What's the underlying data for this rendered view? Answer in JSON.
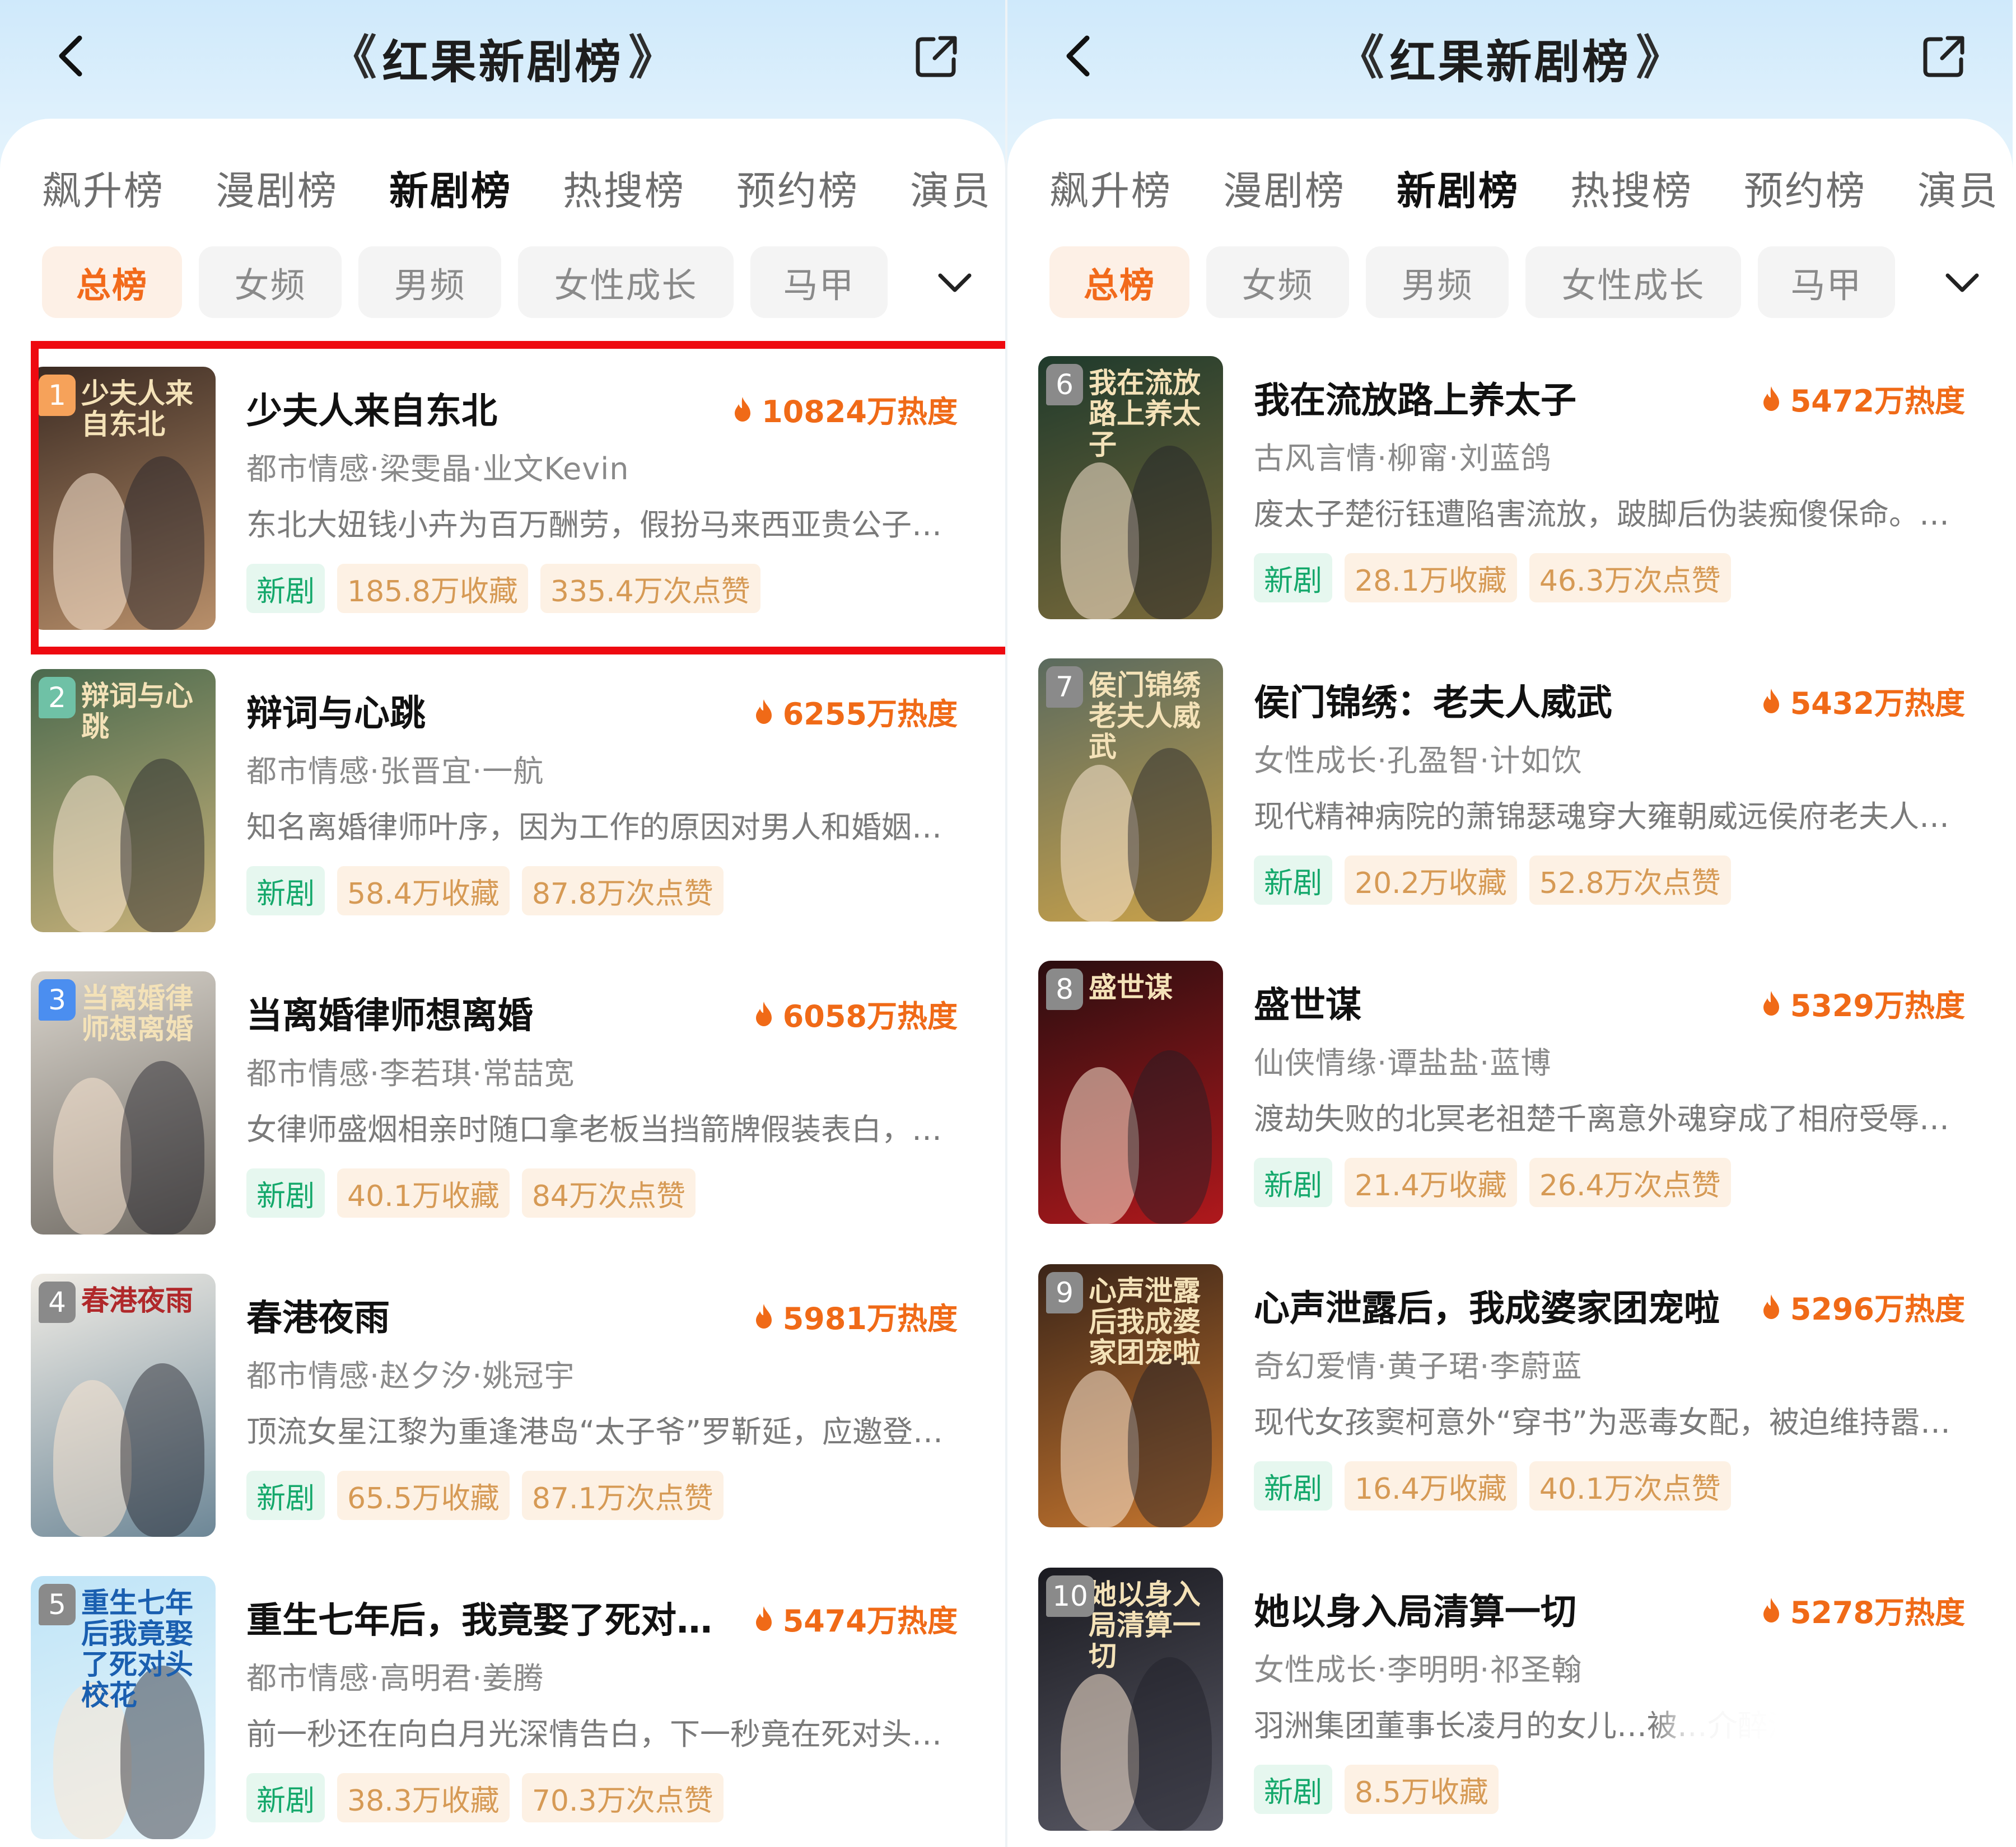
{
  "colors": {
    "accent_orange": "#f06a17",
    "tag_green": "#14a86b",
    "highlight_red": "#ee0a10",
    "header_blue": "#cfe9fb"
  },
  "panels": [
    {
      "header": {
        "title": "红果新剧榜",
        "title_deco_left": "《",
        "title_deco_right": "》"
      },
      "tabs": [
        "飙升榜",
        "漫剧榜",
        "新剧榜",
        "热搜榜",
        "预约榜",
        "演员"
      ],
      "active_tab": 2,
      "filters": [
        "总榜",
        "女频",
        "男频",
        "女性成长",
        "马甲"
      ],
      "active_filter": 0,
      "items": [
        {
          "rank": "1",
          "title": "少夫人来自东北",
          "heat": "10824万热度",
          "meta": "都市情感·梁雯晶·业文Kevin",
          "synopsis": "东北大妞钱小卉为百万酬劳，假扮马来西亚贵公子…",
          "tag_new": "新剧",
          "collect": "185.8万收藏",
          "likes": "335.4万次点赞",
          "poster_text": "少夫人来自东北",
          "rank_color": "#f6a25a",
          "poster_colors": [
            "#3a2a22",
            "#b88f6a"
          ],
          "highlighted": true
        },
        {
          "rank": "2",
          "title": "辩词与心跳",
          "heat": "6255万热度",
          "meta": "都市情感·张晋宜·一航",
          "synopsis": "知名离婚律师叶序，因为工作的原因对男人和婚姻…",
          "tag_new": "新剧",
          "collect": "58.4万收藏",
          "likes": "87.8万次点赞",
          "poster_text": "辩词与心跳",
          "rank_color": "#6fc1a6",
          "poster_colors": [
            "#4b6a4e",
            "#c9b27a"
          ],
          "highlighted": false
        },
        {
          "rank": "3",
          "title": "当离婚律师想离婚",
          "heat": "6058万热度",
          "meta": "都市情感·李若琪·常喆宽",
          "synopsis": "女律师盛烟相亲时随口拿老板当挡箭牌假装表白，…",
          "tag_new": "新剧",
          "collect": "40.1万收藏",
          "likes": "84万次点赞",
          "poster_text": "当离婚律师想离婚",
          "rank_color": "#4b8ef0",
          "poster_colors": [
            "#d9d4cc",
            "#6f6a63"
          ],
          "highlighted": false
        },
        {
          "rank": "4",
          "title": "春港夜雨",
          "heat": "5981万热度",
          "meta": "都市情感·赵夕汐·姚冠宇",
          "synopsis": "顶流女星江黎为重逢港岛“太子爷”罗靳延，应邀登…",
          "tag_new": "新剧",
          "collect": "65.5万收藏",
          "likes": "87.1万次点赞",
          "poster_text": "春港夜雨",
          "rank_color": "#8a8a8a",
          "poster_colors": [
            "#f1ede6",
            "#6d8797"
          ],
          "highlighted": false
        },
        {
          "rank": "5",
          "title": "重生七年后，我竟娶了死对头…",
          "heat": "5474万热度",
          "meta": "都市情感·高明君·姜腾",
          "synopsis": "前一秒还在向白月光深情告白，下一秒竟在死对头…",
          "tag_new": "新剧",
          "collect": "38.3万收藏",
          "likes": "70.3万次点赞",
          "poster_text": "重生七年后我竟娶了死对头校花",
          "rank_color": "#8a8a8a",
          "poster_colors": [
            "#bfe4f7",
            "#e9f6fb"
          ],
          "highlighted": false
        }
      ]
    },
    {
      "header": {
        "title": "红果新剧榜",
        "title_deco_left": "《",
        "title_deco_right": "》"
      },
      "tabs": [
        "飙升榜",
        "漫剧榜",
        "新剧榜",
        "热搜榜",
        "预约榜",
        "演员"
      ],
      "active_tab": 2,
      "filters": [
        "总榜",
        "女频",
        "男频",
        "女性成长",
        "马甲"
      ],
      "active_filter": 0,
      "items": [
        {
          "rank": "6",
          "title": "我在流放路上养太子",
          "heat": "5472万热度",
          "meta": "古风言情·柳甯·刘蓝鸽",
          "synopsis": "废太子楚衍钰遭陷害流放，跛脚后伪装痴傻保命。…",
          "tag_new": "新剧",
          "collect": "28.1万收藏",
          "likes": "46.3万次点赞",
          "poster_text": "我在流放路上养太子",
          "rank_color": "#8a8a8a",
          "poster_colors": [
            "#1f3a2c",
            "#7a6a3a"
          ],
          "highlighted": false
        },
        {
          "rank": "7",
          "title": "侯门锦绣：老夫人威武",
          "heat": "5432万热度",
          "meta": "女性成长·孔盈智·计如饮",
          "synopsis": "现代精神病院的萧锦瑟魂穿大雍朝威远侯府老夫人…",
          "tag_new": "新剧",
          "collect": "20.2万收藏",
          "likes": "52.8万次点赞",
          "poster_text": "侯门锦绣老夫人威武",
          "rank_color": "#8a8a8a",
          "poster_colors": [
            "#5a6a5e",
            "#caa24a"
          ],
          "highlighted": false
        },
        {
          "rank": "8",
          "title": "盛世谋",
          "heat": "5329万热度",
          "meta": "仙侠情缘·谭盐盐·蓝博",
          "synopsis": "渡劫失败的北冥老祖楚千离意外魂穿成了相府受辱…",
          "tag_new": "新剧",
          "collect": "21.4万收藏",
          "likes": "26.4万次点赞",
          "poster_text": "盛世谋",
          "rank_color": "#8a8a8a",
          "poster_colors": [
            "#2a0e10",
            "#b0181c"
          ],
          "highlighted": false
        },
        {
          "rank": "9",
          "title": "心声泄露后，我成婆家团宠啦",
          "heat": "5296万热度",
          "meta": "奇幻爱情·黄子珺·李蔚蓝",
          "synopsis": "现代女孩窦柯意外“穿书”为恶毒女配，被迫维持嚣…",
          "tag_new": "新剧",
          "collect": "16.4万收藏",
          "likes": "40.1万次点赞",
          "poster_text": "心声泄露后我成婆家团宠啦",
          "rank_color": "#8a8a8a",
          "poster_colors": [
            "#3a2418",
            "#c4752e"
          ],
          "highlighted": false
        },
        {
          "rank": "10",
          "title": "她以身入局清算一切",
          "heat": "5278万热度",
          "meta": "女性成长·李明明·祁圣翰",
          "synopsis": "羽洲集团董事长凌月的女儿…被…介醉酒撞车的富",
          "tag_new": "新剧",
          "collect": "8.5万收藏",
          "likes": "",
          "poster_text": "她以身入局清算一切",
          "rank_color": "#8a8a8a",
          "poster_colors": [
            "#1a1a20",
            "#5a5a66"
          ],
          "highlighted": false
        }
      ]
    }
  ]
}
